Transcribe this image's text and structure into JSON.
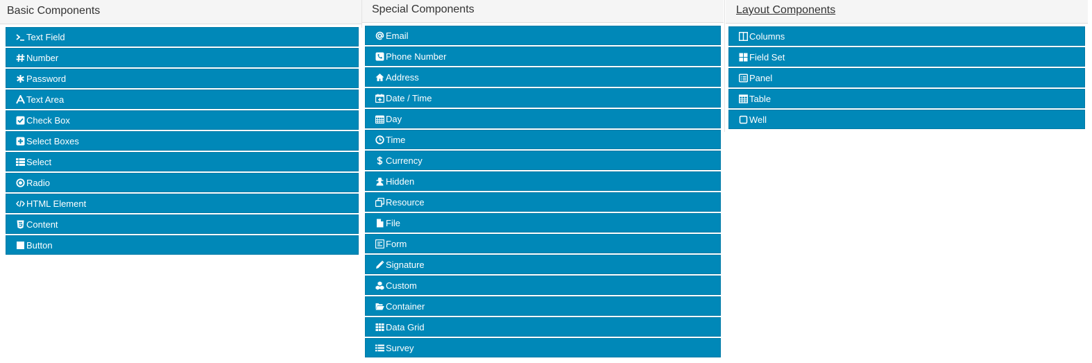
{
  "basic": {
    "title": "Basic Components",
    "items": [
      {
        "label": "Text Field",
        "icon": "terminal-icon"
      },
      {
        "label": "Number",
        "icon": "hashtag-icon"
      },
      {
        "label": "Password",
        "icon": "asterisk-icon"
      },
      {
        "label": "Text Area",
        "icon": "font-icon"
      },
      {
        "label": "Check Box",
        "icon": "check-square-icon"
      },
      {
        "label": "Select Boxes",
        "icon": "plus-square-icon"
      },
      {
        "label": "Select",
        "icon": "th-list-icon"
      },
      {
        "label": "Radio",
        "icon": "dot-circle-icon"
      },
      {
        "label": "HTML Element",
        "icon": "code-icon"
      },
      {
        "label": "Content",
        "icon": "html5-icon"
      },
      {
        "label": "Button",
        "icon": "stop-icon"
      }
    ]
  },
  "special": {
    "title": "Special Components",
    "items": [
      {
        "label": "Email",
        "icon": "at-icon"
      },
      {
        "label": "Phone Number",
        "icon": "phone-square-icon"
      },
      {
        "label": "Address",
        "icon": "home-icon"
      },
      {
        "label": "Date / Time",
        "icon": "calendar-plus-icon"
      },
      {
        "label": "Day",
        "icon": "calendar-icon"
      },
      {
        "label": "Time",
        "icon": "clock-icon"
      },
      {
        "label": "Currency",
        "icon": "usd-icon"
      },
      {
        "label": "Hidden",
        "icon": "user-secret-icon"
      },
      {
        "label": "Resource",
        "icon": "clone-icon"
      },
      {
        "label": "File",
        "icon": "file-icon"
      },
      {
        "label": "Form",
        "icon": "wpforms-icon"
      },
      {
        "label": "Signature",
        "icon": "pencil-icon"
      },
      {
        "label": "Custom",
        "icon": "cubes-icon"
      },
      {
        "label": "Container",
        "icon": "folder-open-icon"
      },
      {
        "label": "Data Grid",
        "icon": "th-icon"
      },
      {
        "label": "Survey",
        "icon": "list-icon"
      }
    ]
  },
  "layout": {
    "title": "Layout Components",
    "items": [
      {
        "label": "Columns",
        "icon": "columns-icon"
      },
      {
        "label": "Field Set",
        "icon": "th-large-icon"
      },
      {
        "label": "Panel",
        "icon": "list-alt-icon"
      },
      {
        "label": "Table",
        "icon": "table-icon"
      },
      {
        "label": "Well",
        "icon": "square-o-icon"
      }
    ]
  },
  "colors": {
    "button_bg": "#0088b8",
    "button_text": "#ffffff",
    "header_bg": "#f5f5f5",
    "header_text": "#333333"
  }
}
